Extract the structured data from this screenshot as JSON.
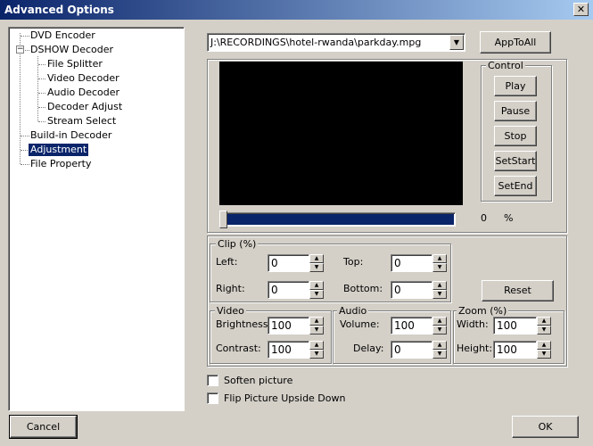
{
  "window": {
    "title": "Advanced Options",
    "close_glyph": "✕"
  },
  "tree": {
    "items": [
      {
        "label": "DVD Encoder"
      },
      {
        "label": "DSHOW Decoder",
        "expander": "−"
      },
      {
        "label": "File Splitter"
      },
      {
        "label": "Video Decoder"
      },
      {
        "label": "Audio Decoder"
      },
      {
        "label": "Decoder Adjust"
      },
      {
        "label": "Stream Select"
      },
      {
        "label": "Build-in Decoder"
      },
      {
        "label": "Adjustment",
        "selected": true
      },
      {
        "label": "File Property"
      }
    ]
  },
  "file_select": {
    "value": "J:\\RECORDINGS\\hotel-rwanda\\parkday.mpg",
    "arrow": "▼"
  },
  "apply_all_label": "AppToAll",
  "control": {
    "legend": "Control",
    "play": "Play",
    "pause": "Pause",
    "stop": "Stop",
    "set_start": "SetStart",
    "set_end": "SetEnd"
  },
  "progress": {
    "value": "0",
    "unit": "%",
    "fraction": 0
  },
  "clip": {
    "legend": "Clip (%)",
    "left_label": "Left:",
    "left_value": "0",
    "top_label": "Top:",
    "top_value": "0",
    "right_label": "Right:",
    "right_value": "0",
    "bottom_label": "Bottom:",
    "bottom_value": "0",
    "reset_label": "Reset"
  },
  "video": {
    "legend": "Video",
    "brightness_label": "Brightness:",
    "brightness_value": "100",
    "contrast_label": "Contrast:",
    "contrast_value": "100"
  },
  "audio": {
    "legend": "Audio",
    "volume_label": "Volume:",
    "volume_value": "100",
    "delay_label": "Delay:",
    "delay_value": "0"
  },
  "zoom": {
    "legend": "Zoom (%)",
    "width_label": "Width:",
    "width_value": "100",
    "height_label": "Height:",
    "height_value": "100"
  },
  "options": {
    "soften_label": "Soften picture",
    "flip_label": "Flip Picture Upside Down"
  },
  "footer": {
    "cancel_label": "Cancel",
    "ok_label": "OK"
  },
  "spin_glyphs": {
    "up": "▲",
    "down": "▼"
  },
  "colors": {
    "title_start": "#0a246a",
    "title_end": "#a6caf0",
    "selected_bg": "#0a246a",
    "progress_fill": "#0a246a",
    "preview_bg": "#000000"
  }
}
